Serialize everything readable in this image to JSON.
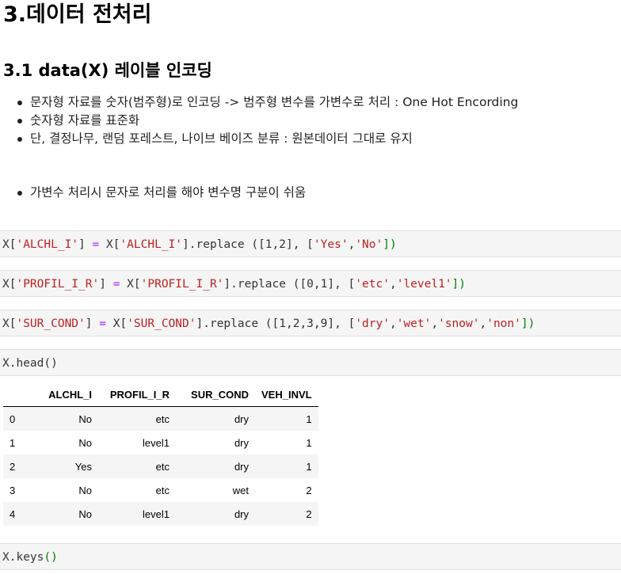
{
  "heading": "3.데이터 전처리",
  "subheading": "3.1 data(X) 레이블 인코딩",
  "bullets": [
    "문자형 자료를 숫자(범주형)로 인코딩 -> 범주형 변수를 가변수로 처리 : One Hot Encording",
    "숫자형 자료를 표준화",
    "단, 결정나무, 랜덤 포레스트, 나이브 베이즈 분류 : 원본데이터 그대로 유지"
  ],
  "bullets2": [
    "가변수 처리시 문자로 처리를 해야 변수명 구분이 쉬움"
  ],
  "cells": [
    {
      "parts": [
        "X[",
        "'ALCHL_I'",
        "] ",
        "=",
        " X[",
        "'ALCHL_I'",
        "].replace (",
        "[1,2]",
        ", [",
        "'Yes'",
        ",",
        "'No'",
        "])"
      ]
    },
    {
      "parts": [
        "X[",
        "'PROFIL_I_R'",
        "] ",
        "=",
        " X[",
        "'PROFIL_I_R'",
        "].replace (",
        "[0,1]",
        ", [",
        "'etc'",
        ",",
        "'level1'",
        "])"
      ]
    },
    {
      "parts": [
        "X[",
        "'SUR_COND'",
        "] ",
        "=",
        " X[",
        "'SUR_COND'",
        "].replace (",
        "[1,2,3,9]",
        ", [",
        "'dry'",
        ",",
        "'wet'",
        ",",
        "'snow'",
        ",",
        "'non'",
        "])"
      ]
    },
    {
      "parts": [
        "X.head()"
      ]
    },
    {
      "parts": [
        "X.keys()"
      ]
    }
  ],
  "table": {
    "columns": [
      "",
      "ALCHL_I",
      "PROFIL_I_R",
      "SUR_COND",
      "VEH_INVL"
    ],
    "rows": [
      [
        "0",
        "No",
        "etc",
        "dry",
        "1"
      ],
      [
        "1",
        "No",
        "level1",
        "dry",
        "1"
      ],
      [
        "2",
        "Yes",
        "etc",
        "dry",
        "1"
      ],
      [
        "3",
        "No",
        "etc",
        "wet",
        "2"
      ],
      [
        "4",
        "No",
        "level1",
        "dry",
        "2"
      ]
    ]
  },
  "colors": {
    "string": "#ba2121",
    "operator": "#aa22ff",
    "number": "#008000",
    "cell_bg": "#f5f5f5"
  }
}
